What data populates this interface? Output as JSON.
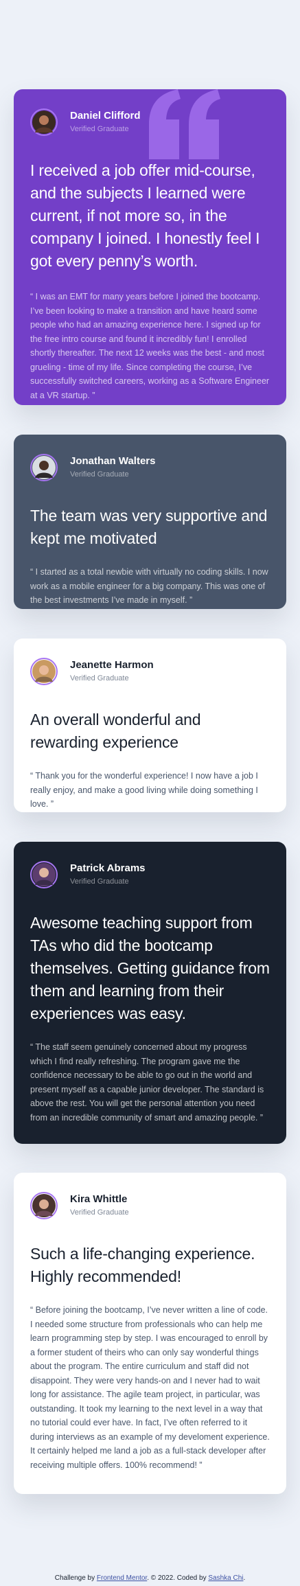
{
  "colors": {
    "page_bg": "#edf1f8",
    "moderate_violet": "#733fc8",
    "grayish_blue": "#48556a",
    "white": "#ffffff",
    "very_dark_blackish_blue": "#19212e",
    "light_violet": "#a775f1"
  },
  "testimonials": [
    {
      "name": "Daniel Clifford",
      "role": "Verified Graduate",
      "headline": "I received a job offer mid-course, and the subjects I learned were current, if not more so, in the company I joined. I honestly feel I got every penny’s worth.",
      "body": "“ I was an EMT for many years before I joined the bootcamp. I’ve been looking to make a transition and have heard some people who had an amazing experience here. I signed up for the free intro course and found it incredibly fun! I enrolled shortly thereafter. The next 12 weeks was the best - and most grueling - time of my life. Since completing the course, I’ve successfully switched careers, working as a Software Engineer at a VR startup. ”",
      "avatar_icon": "user-avatar-icon"
    },
    {
      "name": "Jonathan Walters",
      "role": "Verified Graduate",
      "headline": "The team was very supportive and kept me motivated",
      "body": "“ I started as a total newbie with virtually no coding skills. I now work as a mobile engineer for a big company. This was one of the best investments I’ve made in myself. ”",
      "avatar_icon": "user-avatar-icon"
    },
    {
      "name": "Jeanette Harmon",
      "role": "Verified Graduate",
      "headline": "An overall wonderful and rewarding experience",
      "body": "“ Thank you for the wonderful experience! I now have a job I really enjoy, and make a good living while doing something I love. ”",
      "avatar_icon": "user-avatar-icon"
    },
    {
      "name": "Patrick Abrams",
      "role": "Verified Graduate",
      "headline": "Awesome teaching support from TAs who did the bootcamp themselves. Getting guidance from them and learning from their experiences was easy.",
      "body": "“ The staff seem genuinely concerned about my progress which I find really refreshing. The program gave me the confidence necessary to be able to go out in the world and present myself as a capable junior developer. The standard is above the rest. You will get the personal attention you need from an incredible community of smart and amazing people. ”",
      "avatar_icon": "user-avatar-icon"
    },
    {
      "name": "Kira Whittle",
      "role": "Verified Graduate",
      "headline": "Such a life-changing experience. Highly recommended!",
      "body": "“ Before joining the bootcamp, I’ve never written a line of code. I needed some structure from professionals who can help me learn programming step by step. I was encouraged to enroll by a former student of theirs who can only say wonderful things about the program. The entire curriculum and staff did not disappoint. They were very hands-on and I never had to wait long for assistance. The agile team project, in particular, was outstanding. It took my learning to the next level in a way that no tutorial could ever have. In fact, I’ve often referred to it during interviews as an example of my develoment experience. It certainly helped me land a job as a full-stack developer after receiving multiple offers. 100% recommend! ”",
      "avatar_icon": "user-avatar-icon"
    }
  ],
  "decoration": {
    "quote_icon": "quotation-mark-icon"
  },
  "attribution": {
    "prefix": "Challenge by",
    "link1": "Frontend Mentor",
    "middle": ". © 2022. Coded by",
    "link2": "Sashka Chi",
    "suffix": "."
  }
}
